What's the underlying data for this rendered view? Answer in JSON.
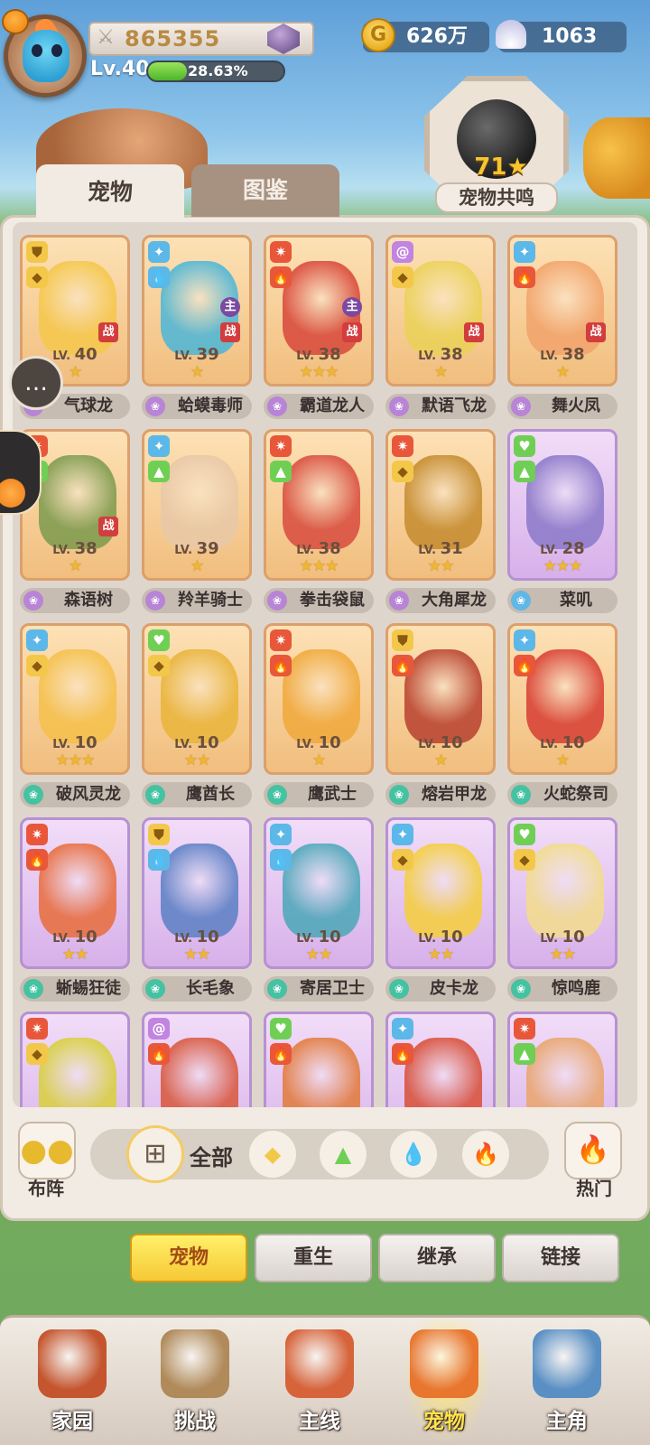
{
  "header": {
    "score": "865355",
    "level": "Lv.40",
    "exp_percent": "28.63%",
    "exp_fraction": 0.2863,
    "coins": "626万",
    "shells": "1063"
  },
  "resonance": {
    "count": "71",
    "label": "宠物共鸣"
  },
  "tabs": {
    "pets": "宠物",
    "dex": "图鉴"
  },
  "pets": [
    {
      "name": "气球龙",
      "level": "40",
      "stars": 1,
      "rarity": "orange",
      "paw": "purple",
      "el": [
        "shield",
        "rock"
      ],
      "badges": [
        "battle"
      ],
      "art": "#f5c74a"
    },
    {
      "name": "蛤蟆毒师",
      "level": "39",
      "stars": 1,
      "rarity": "orange",
      "paw": "purple",
      "el": [
        "spark",
        "water"
      ],
      "badges": [
        "main",
        "battle"
      ],
      "art": "#4ab6d8"
    },
    {
      "name": "霸道龙人",
      "level": "38",
      "stars": 3,
      "rarity": "orange",
      "paw": "purple",
      "el": [
        "claw",
        "fire"
      ],
      "badges": [
        "main",
        "battle"
      ],
      "art": "#d8463a"
    },
    {
      "name": "默语飞龙",
      "level": "38",
      "stars": 1,
      "rarity": "orange",
      "paw": "purple",
      "el": [
        "swirl",
        "rock"
      ],
      "badges": [
        "battle"
      ],
      "art": "#ead257"
    },
    {
      "name": "舞火凤",
      "level": "38",
      "stars": 1,
      "rarity": "orange",
      "paw": "purple",
      "el": [
        "spark",
        "fire"
      ],
      "badges": [
        "battle"
      ],
      "art": "#f2a36b"
    },
    {
      "name": "森语树",
      "level": "38",
      "stars": 1,
      "rarity": "orange",
      "paw": "purple",
      "el": [
        "claw",
        "grass"
      ],
      "badges": [
        "battle"
      ],
      "art": "#7b9a4d"
    },
    {
      "name": "羚羊骑士",
      "level": "39",
      "stars": 1,
      "rarity": "orange",
      "paw": "purple",
      "el": [
        "spark",
        "grass"
      ],
      "badges": [],
      "art": "#e8c8a8"
    },
    {
      "name": "拳击袋鼠",
      "level": "38",
      "stars": 3,
      "rarity": "orange",
      "paw": "purple",
      "el": [
        "claw",
        "grass"
      ],
      "badges": [],
      "art": "#d84b3e"
    },
    {
      "name": "大角犀龙",
      "level": "31",
      "stars": 2,
      "rarity": "orange",
      "paw": "purple",
      "el": [
        "claw",
        "rock"
      ],
      "badges": [],
      "art": "#c48b2e"
    },
    {
      "name": "菜叽",
      "level": "28",
      "stars": 3,
      "rarity": "purple",
      "paw": "blue",
      "el": [
        "heart",
        "grass"
      ],
      "badges": [],
      "art": "#8a78c8"
    },
    {
      "name": "破风灵龙",
      "level": "10",
      "stars": 3,
      "rarity": "orange",
      "paw": "teal",
      "el": [
        "spark",
        "rock"
      ],
      "badges": [],
      "art": "#f5c04a"
    },
    {
      "name": "鹰酋长",
      "level": "10",
      "stars": 2,
      "rarity": "orange",
      "paw": "teal",
      "el": [
        "heart",
        "rock"
      ],
      "badges": [],
      "art": "#e9b43a"
    },
    {
      "name": "鹰武士",
      "level": "10",
      "stars": 1,
      "rarity": "orange",
      "paw": "teal",
      "el": [
        "claw",
        "fire"
      ],
      "badges": [],
      "art": "#f0a83a"
    },
    {
      "name": "熔岩甲龙",
      "level": "10",
      "stars": 1,
      "rarity": "orange",
      "paw": "teal",
      "el": [
        "shield",
        "fire"
      ],
      "badges": [],
      "art": "#b8402e"
    },
    {
      "name": "火蛇祭司",
      "level": "10",
      "stars": 1,
      "rarity": "orange",
      "paw": "teal",
      "el": [
        "spark",
        "fire"
      ],
      "badges": [],
      "art": "#d83d33"
    },
    {
      "name": "蜥蜴狂徒",
      "level": "10",
      "stars": 2,
      "rarity": "purple",
      "paw": "teal",
      "el": [
        "claw",
        "fire"
      ],
      "badges": [],
      "art": "#e86c3a"
    },
    {
      "name": "长毛象",
      "level": "10",
      "stars": 2,
      "rarity": "purple",
      "paw": "teal",
      "el": [
        "shield",
        "water"
      ],
      "badges": [],
      "art": "#5a7fc4"
    },
    {
      "name": "寄居卫士",
      "level": "10",
      "stars": 2,
      "rarity": "purple",
      "paw": "teal",
      "el": [
        "spark",
        "water"
      ],
      "badges": [],
      "art": "#4aa7b8"
    },
    {
      "name": "皮卡龙",
      "level": "10",
      "stars": 2,
      "rarity": "purple",
      "paw": "teal",
      "el": [
        "spark",
        "rock"
      ],
      "badges": [],
      "art": "#f5cf3a"
    },
    {
      "name": "惊鸣鹿",
      "level": "10",
      "stars": 2,
      "rarity": "purple",
      "paw": "teal",
      "el": [
        "heart",
        "rock"
      ],
      "badges": [],
      "art": "#f2dd8a"
    },
    {
      "name": "",
      "level": "",
      "stars": 0,
      "rarity": "purple",
      "paw": "teal",
      "el": [
        "claw",
        "rock"
      ],
      "badges": [],
      "art": "#d8d03a"
    },
    {
      "name": "",
      "level": "",
      "stars": 0,
      "rarity": "purple",
      "paw": "teal",
      "el": [
        "swirl",
        "fire"
      ],
      "badges": [],
      "art": "#d8563a"
    },
    {
      "name": "",
      "level": "",
      "stars": 0,
      "rarity": "purple",
      "paw": "teal",
      "el": [
        "heart",
        "fire"
      ],
      "badges": [],
      "art": "#e27a3a"
    },
    {
      "name": "",
      "level": "",
      "stars": 0,
      "rarity": "purple",
      "paw": "teal",
      "el": [
        "spark",
        "fire"
      ],
      "badges": [],
      "art": "#d84e36"
    },
    {
      "name": "",
      "level": "",
      "stars": 0,
      "rarity": "purple",
      "paw": "teal",
      "el": [
        "claw",
        "grass"
      ],
      "badges": [],
      "art": "#e9a56a"
    }
  ],
  "badge_text": {
    "main": "主",
    "battle": "战",
    "lv_prefix": "LV."
  },
  "filters": {
    "team_label": "布阵",
    "all_label": "全部",
    "hot_label": "热门",
    "types": [
      "rock",
      "grass",
      "water",
      "fire"
    ]
  },
  "actions": [
    {
      "label": "宠物",
      "active": true
    },
    {
      "label": "重生",
      "active": false
    },
    {
      "label": "继承",
      "active": false
    },
    {
      "label": "链接",
      "active": false
    }
  ],
  "nav": [
    {
      "label": "家园",
      "active": false,
      "icon": "home-icon",
      "color": "#c4552e"
    },
    {
      "label": "挑战",
      "active": false,
      "icon": "challenge-icon",
      "color": "#b08a5a"
    },
    {
      "label": "主线",
      "active": false,
      "icon": "mainline-icon",
      "color": "#d6633a"
    },
    {
      "label": "宠物",
      "active": true,
      "icon": "pet-icon",
      "color": "#e8762e"
    },
    {
      "label": "主角",
      "active": false,
      "icon": "hero-icon",
      "color": "#5a8fc4"
    }
  ],
  "colors": {
    "orange_card": "#f1be7e",
    "purple_card": "#d7b0ea",
    "active_button": "#f6c835",
    "star": "#f0b632"
  }
}
